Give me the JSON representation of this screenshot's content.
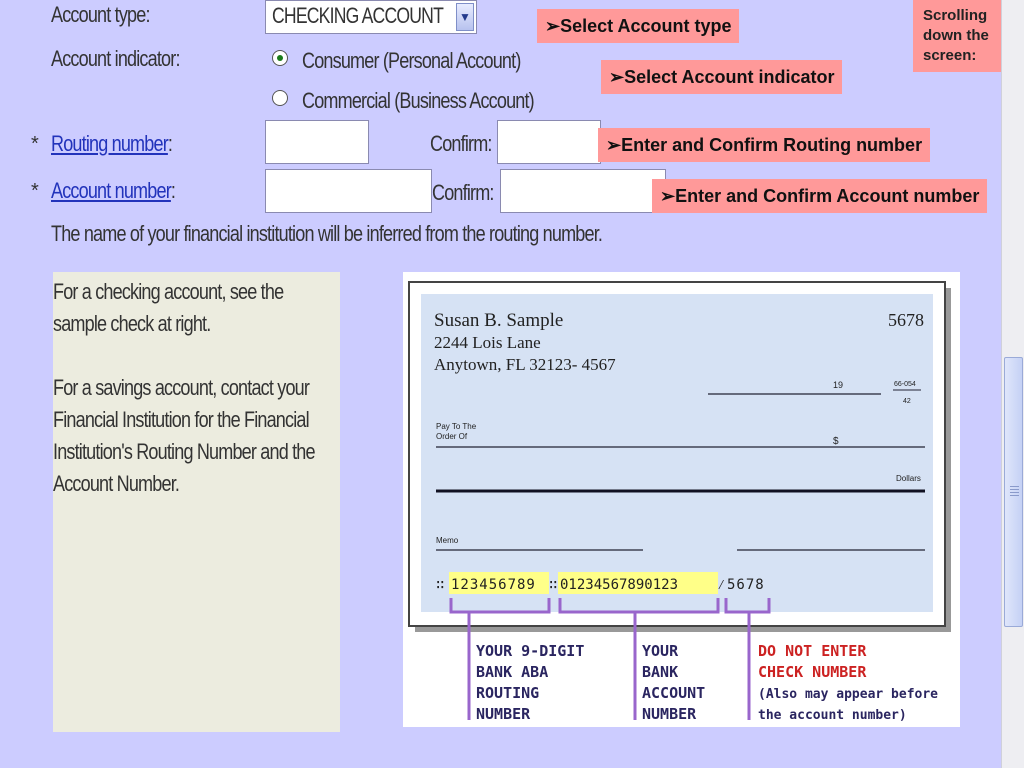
{
  "form": {
    "account_type_label": "Account type:",
    "account_type_value": "CHECKING ACCOUNT",
    "account_indicator_label": "Account indicator:",
    "radio_consumer": "Consumer   (Personal Account)",
    "radio_commercial": "Commercial (Business Account)",
    "routing_star": "*",
    "routing_label": "Routing number",
    "routing_colon": ":",
    "routing_confirm_label": "Confirm:",
    "account_star": "*",
    "account_label": "Account number",
    "account_colon": ":",
    "account_confirm_label": "Confirm:",
    "inferred_note": "The name of your financial institution will be inferred from the routing number."
  },
  "callouts": {
    "select_type": "➢Select Account type",
    "select_indicator": "➢Select Account indicator",
    "routing": "➢Enter and Confirm Routing number",
    "account": "➢Enter and Confirm Account number",
    "scrolling_note": "Scrolling down the screen:"
  },
  "info": {
    "checking": "For a checking account, see the sample check at right.",
    "savings": "For a savings account, contact your Financial Institution for the Financial Institution's Routing Number and the Account Number."
  },
  "check": {
    "name": "Susan B. Sample",
    "address1": "2244 Lois Lane",
    "address2": "Anytown, FL 32123- 4567",
    "number": "5678",
    "fraction_top": "66-054",
    "fraction_bottom": "42",
    "date_marker": "19",
    "pay_to_1": "Pay To The",
    "pay_to_2": "Order Of",
    "dollar_sign": "$",
    "dollars": "Dollars",
    "memo": "Memo",
    "micr_routing": "123456789",
    "micr_account": "01234567890123",
    "micr_check": "5678",
    "caption_routing": [
      "YOUR 9-DIGIT",
      "BANK ABA",
      "ROUTING",
      "NUMBER"
    ],
    "caption_account": [
      "YOUR",
      "BANK",
      "ACCOUNT",
      "NUMBER"
    ],
    "caption_check_1": [
      "DO NOT ENTER",
      "CHECK NUMBER"
    ],
    "caption_check_2": [
      "(Also may appear before",
      "the account number)"
    ],
    "highlight_color": "#ffff88",
    "bracket_color": "#9966cc",
    "warning_color": "#cc2222"
  }
}
